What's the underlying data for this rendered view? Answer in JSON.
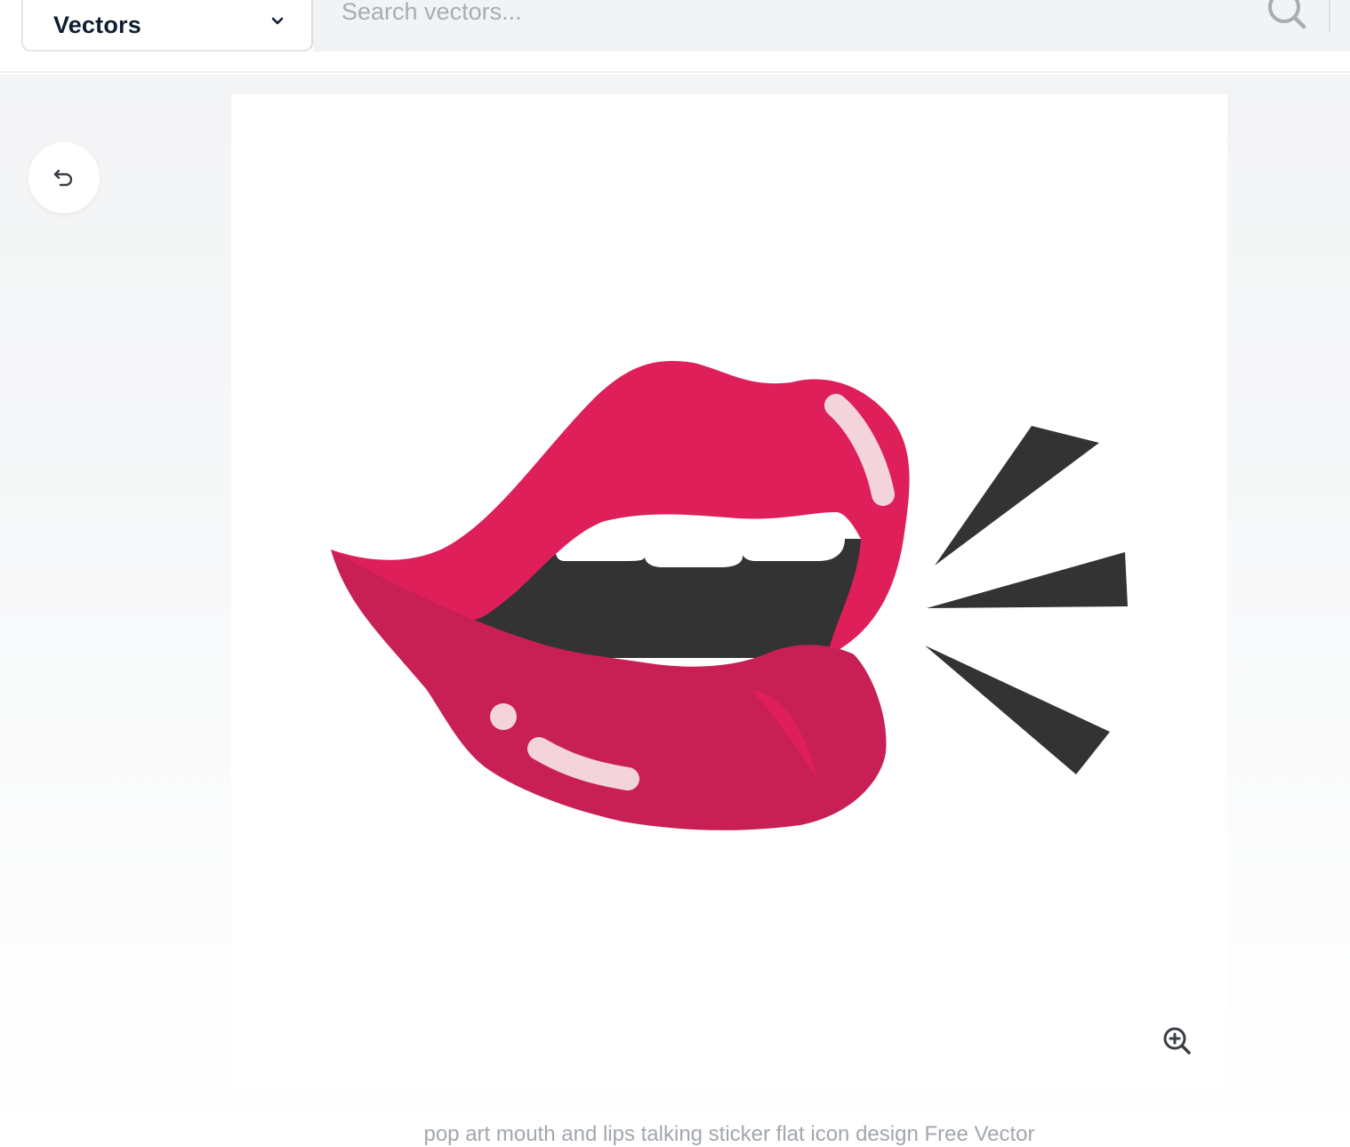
{
  "header": {
    "type_select": {
      "selected": "Vectors"
    },
    "search": {
      "placeholder": "Search vectors..."
    }
  },
  "icons": {
    "chevron": "chevron-down-icon",
    "search": "search-icon",
    "back": "undo-arrow-icon",
    "zoom": "zoom-in-icon"
  },
  "preview": {
    "caption": "pop art mouth and lips talking sticker flat icon design Free Vector"
  },
  "colors": {
    "lip_upper": "#de1f5a",
    "lip_lower": "#c82055",
    "mouth_dark": "#333333",
    "highlight": "#f4d4db",
    "text_dark": "#0f1f33",
    "placeholder": "#a8adb4"
  }
}
